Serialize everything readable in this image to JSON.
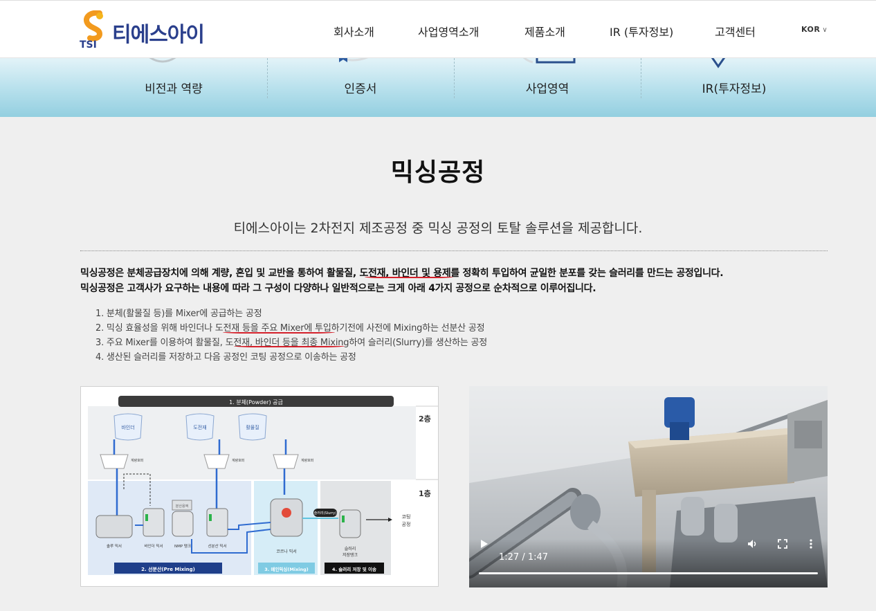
{
  "header": {
    "logo_text": "티에스아이",
    "logo_mark": "TSI",
    "nav": [
      {
        "label": "회사소개"
      },
      {
        "label": "사업영역소개"
      },
      {
        "label": "제품소개"
      },
      {
        "label": "IR (투자정보)"
      },
      {
        "label": "고객센터"
      }
    ],
    "lang": "KOR"
  },
  "subnav": [
    {
      "label": "비전과 역량"
    },
    {
      "label": "인증서"
    },
    {
      "label": "사업영역"
    },
    {
      "label": "IR(투자정보)"
    }
  ],
  "content": {
    "title": "믹싱공정",
    "subtitle": "티에스아이는 2차전지 제조공정 중 믹싱 공정의 토탈 솔루션을 제공합니다.",
    "desc": [
      "믹싱공정은 분체공급장치에 의해 계량, 혼입 및 교반을 통하여 활물질, 도전재, 바인더 및 용제를 정확히 투입하여 균일한 분포를 갖는 슬러리를 만드는 공정입니다.",
      "믹싱공정은 고객사가 요구하는 내용에 따라 그 구성이 다양하나 일반적으로는 크게 아래 4가지 공정으로 순차적으로 이루어집니다."
    ],
    "steps": [
      "1. 분체(활물질 등)를 Mixer에 공급하는 공정",
      "2. 믹싱 효율성을 위해 바인더나 도전재 등을 주요 Mixer에 투입하기전에 사전에 Mixing하는 선분산 공정",
      "3. 주요 Mixer를 이용하여 활물질, 도전재, 바인더 등을 최종 Mixing하여 슬러리(Slurry)를 생산하는 공정",
      "4. 생산된 슬러리를 저장하고 다음 공정인 코팅 공정으로 이송하는 공정"
    ]
  },
  "diagram": {
    "top_banner": "1. 분체(Powder) 공급",
    "floor2": "2층",
    "floor1": "1층",
    "bags": [
      "바인더",
      "도전재",
      "활물질"
    ],
    "hopper": "계량호퍼",
    "premix_box": "분산용액",
    "slurry_tag": "슬러리(Slurry)",
    "coating": [
      "코팅",
      "공정"
    ],
    "machines": [
      "솔루 믹서",
      "바인더 믹서",
      "NMP 탱크",
      "선분산 믹서",
      "코르나 믹서"
    ],
    "storage": [
      "슬러리",
      "저장탱크"
    ],
    "sections": [
      "2. 선분산(Pre Mixing)",
      "3. 메인믹싱(Mixing)",
      "4. 슬러리 저장 및 이송"
    ]
  },
  "video": {
    "time": "1:27 / 1:47",
    "progress": 0.81,
    "icons": [
      "play-icon",
      "volume-icon",
      "fullscreen-icon",
      "more-icon"
    ]
  },
  "colors": {
    "accent": "#2a3f8c",
    "underline": "#d4202a",
    "banner": "#93cfe0"
  }
}
